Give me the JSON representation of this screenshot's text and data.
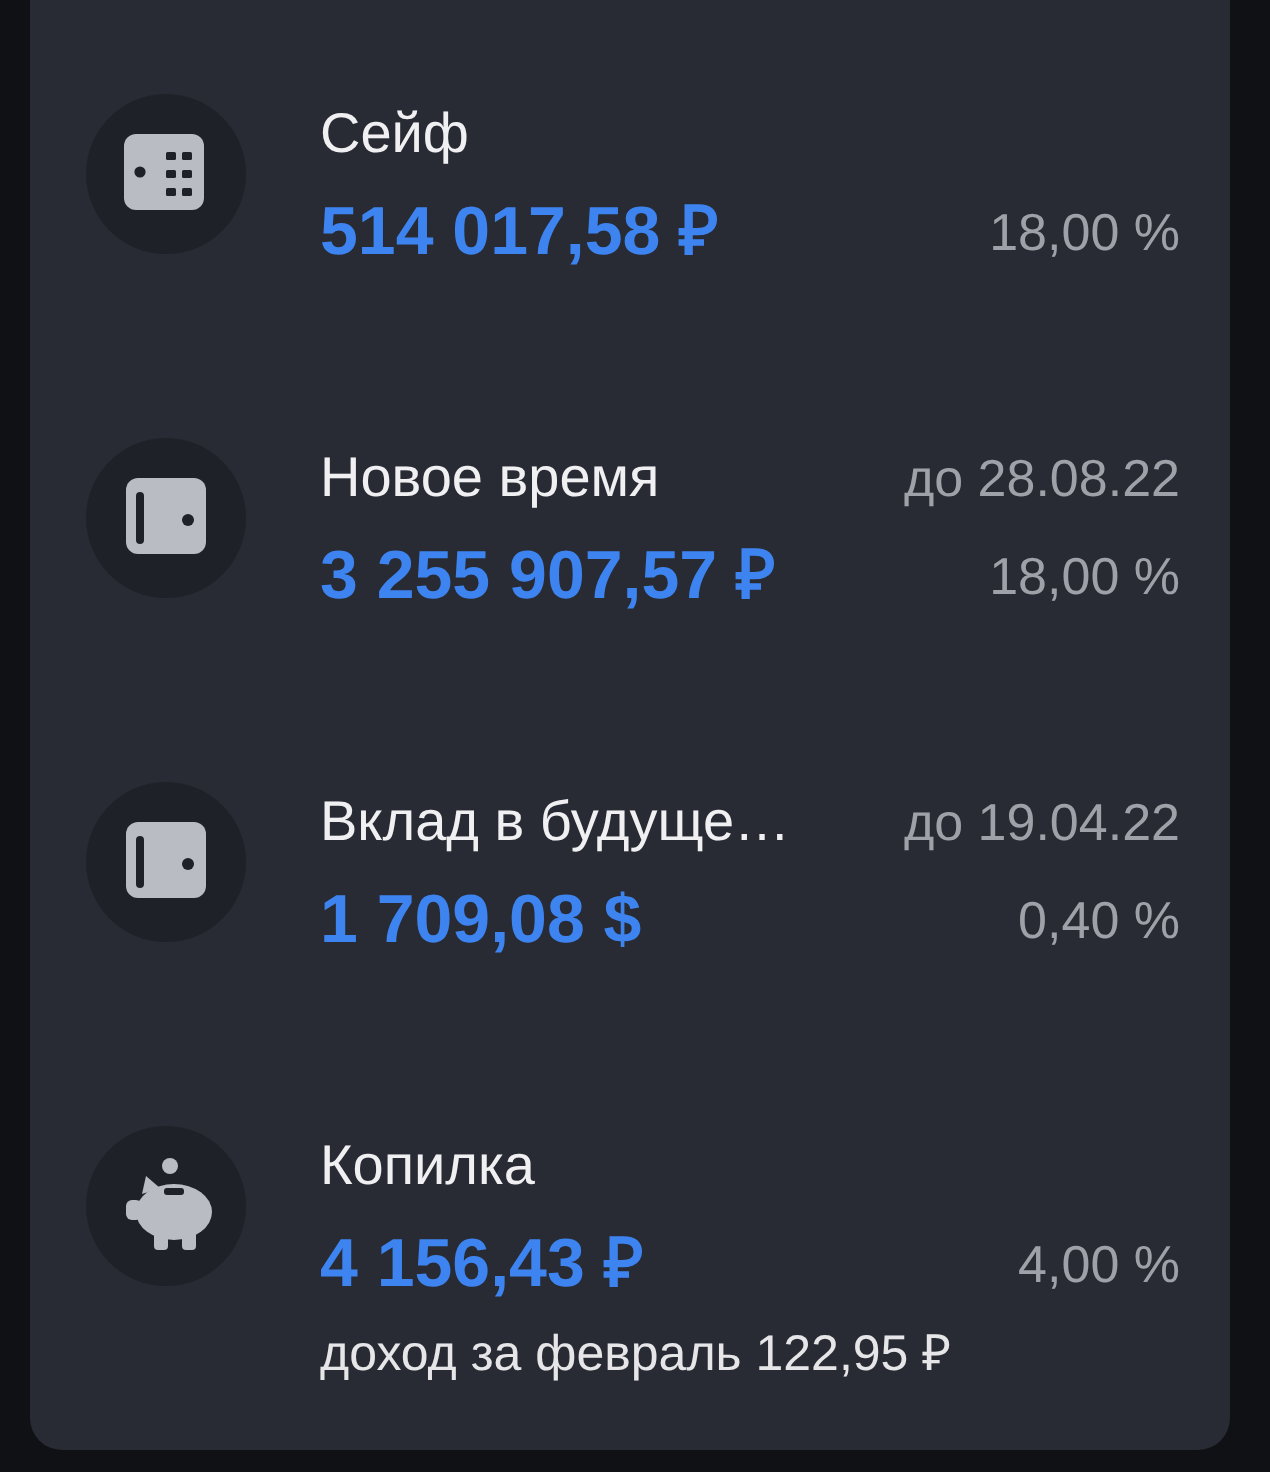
{
  "accounts": [
    {
      "kind": "safe",
      "name": "Сейф",
      "amount": "514 017,58 ₽",
      "rate": "18,00 %"
    },
    {
      "kind": "deposit",
      "name": "Новое время",
      "term": "до 28.08.22",
      "amount": "3 255 907,57 ₽",
      "rate": "18,00 %"
    },
    {
      "kind": "deposit",
      "name": "Вклад в будуще…",
      "term": "до 19.04.22",
      "amount": "1 709,08 $",
      "rate": "0,40 %"
    },
    {
      "kind": "piggy",
      "name": "Копилка",
      "amount": "4 156,43 ₽",
      "rate": "4,00 %",
      "note": "доход за февраль 122,95 ₽"
    }
  ]
}
